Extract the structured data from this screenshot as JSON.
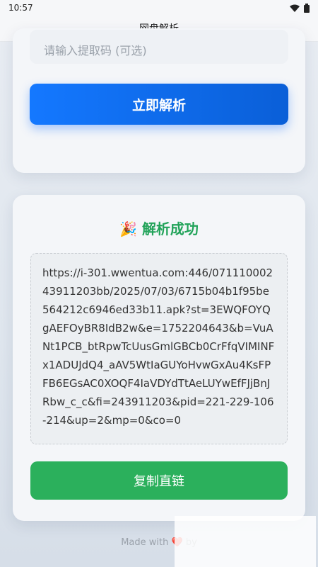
{
  "status": {
    "time": "10:57"
  },
  "app": {
    "title": "网盘解析"
  },
  "form": {
    "code_placeholder": "请输入提取码 (可选)",
    "parse_button": "立即解析"
  },
  "result": {
    "emoji": "🎉",
    "title": "解析成功",
    "url": "https://i-301.wwentua.com:446/07111000243911203bb/2025/07/03/6715b04b1f95be564212c6946ed33b11.apk?st=3EWQFOYQgAEFOyBR8IdB2w&e=1752204643&b=VuANt1PCB_btRpwTcUusGmlGBCb0CrFfqVIMINFx1ADUJdQ4_aAV5WtIaGUYoHvwGxAu4KsFPFB6EGsAC0XOQF4IaVDYdTtAeLUYwEfFJjBnJRbw_c_c&fi=243911203&pid=221-229-106-214&up=2&mp=0&co=0",
    "copy_button": "复制直链"
  },
  "footer": {
    "text": "Made with ❤️ by"
  }
}
